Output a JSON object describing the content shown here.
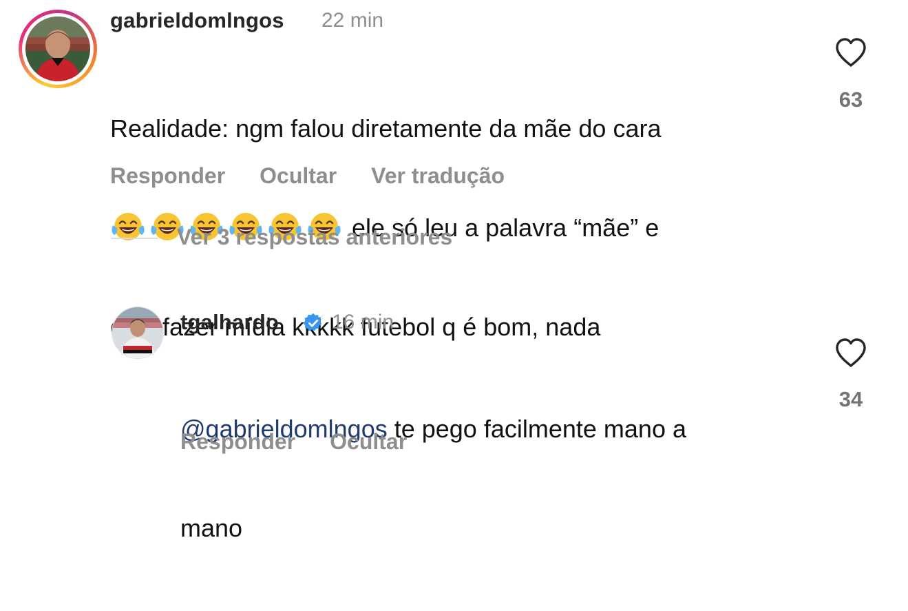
{
  "comment1": {
    "username": "gabrieldomlngos",
    "time": "22 min",
    "text_line1": "Realidade: ngm falou diretamente da mãe do cara",
    "text_line2_after_emojis": "ele só leu a palavra “mãe” e",
    "text_line3": "quis fazer mídia kkkkk futebol q é bom, nada",
    "emoji_icon": "face-with-tears-of-joy-icon",
    "emoji_count": 6,
    "actions": {
      "reply": "Responder",
      "hide": "Ocultar",
      "translate": "Ver tradução"
    },
    "likes": "63"
  },
  "replies_toggle": {
    "label": "Ver 3 respostas anteriores"
  },
  "reply1": {
    "username": "tgalhardo",
    "verified_icon": "verified-badge-icon",
    "time": "16 min",
    "mention": "@gabrieldomlngos",
    "text_rest": " te pego facilmente mano a",
    "text_line2": "mano",
    "actions": {
      "reply": "Responder",
      "hide": "Ocultar"
    },
    "likes": "34"
  },
  "colors": {
    "muted": "#8e8e8e",
    "mention": "#1f3a70",
    "verified": "#3797f0",
    "story_ring_start": "#f9ce34",
    "story_ring_end": "#ee2a7b"
  }
}
